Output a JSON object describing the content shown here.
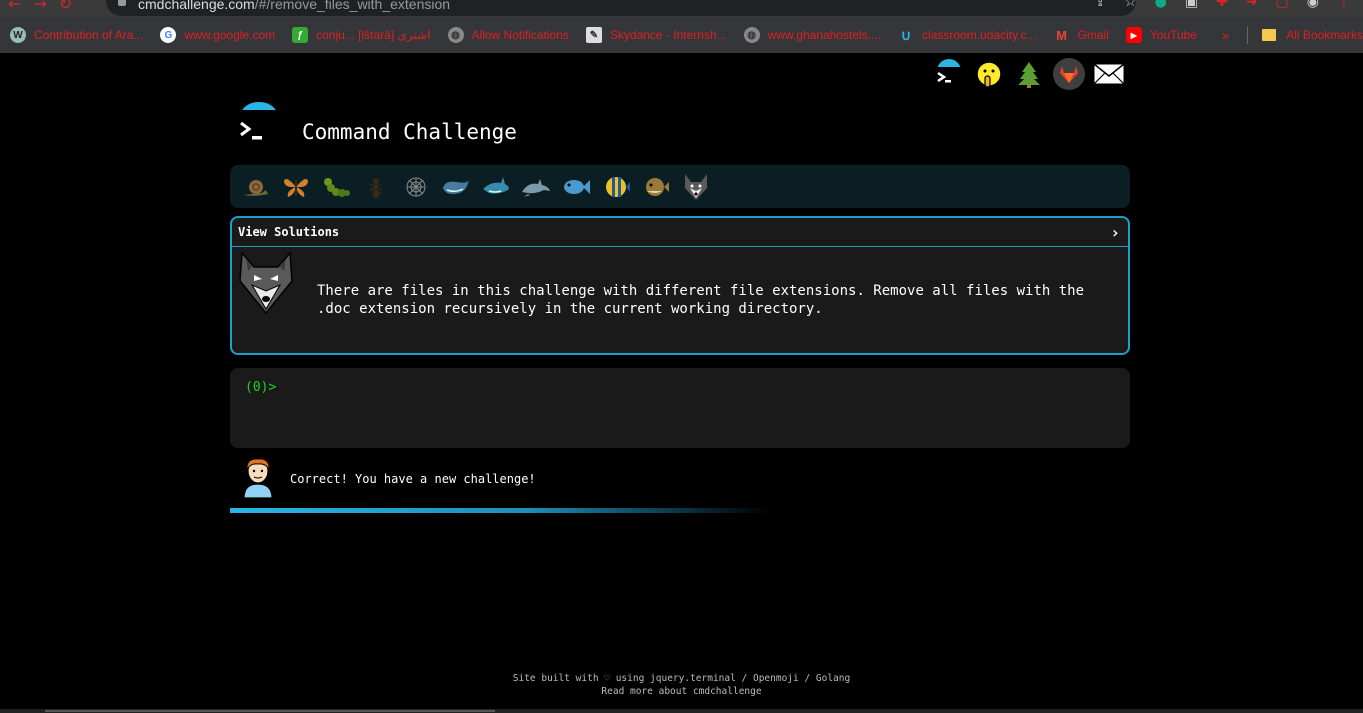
{
  "browser": {
    "url_host": "cmdchallenge.com",
    "url_path": "/#/remove_files_with_extension",
    "bookmarks": [
      {
        "label": "Contribution of Ara...",
        "icon": "wordpress-icon"
      },
      {
        "label": "www.google.com",
        "icon": "google-icon"
      },
      {
        "label": "conju... [ištarā] اشترى",
        "icon": "leaf-icon"
      },
      {
        "label": "Allow Notifications",
        "icon": "globe-icon"
      },
      {
        "label": "Skydance - Internsh...",
        "icon": "pen-icon"
      },
      {
        "label": "www.ghanahostels....",
        "icon": "globe-icon"
      },
      {
        "label": "classroom.udacity.c...",
        "icon": "udacity-icon"
      },
      {
        "label": "Gmail",
        "icon": "gmail-icon"
      },
      {
        "label": "YouTube",
        "icon": "youtube-icon"
      }
    ],
    "more_label": "»",
    "all_bookmarks_label": "All Bookmarks"
  },
  "site": {
    "title": "Command Challenge",
    "challenge": {
      "view_solutions_label": "View Solutions",
      "description": "There are files in this challenge with different file extensions. Remove all files with the .doc extension recursively in the current working directory."
    },
    "terminal": {
      "prompt": "(0)>"
    },
    "message": "Correct! You have a new challenge!",
    "footer": {
      "line1": "Site built with ♡ using jquery.terminal / Openmoji / Golang",
      "line2": "Read more about cmdchallenge"
    },
    "levels": [
      "snail-icon",
      "butterfly-icon",
      "caterpillar-icon",
      "ant-icon",
      "web-icon",
      "whale-icon",
      "shark-icon",
      "dolphin-icon",
      "fish-icon",
      "tropical-fish-icon",
      "blowfish-icon",
      "wolf-icon"
    ],
    "colors": {
      "accent": "#29b6e6",
      "prompt": "#1fd31f",
      "bookmark_text": "#e02020"
    }
  }
}
